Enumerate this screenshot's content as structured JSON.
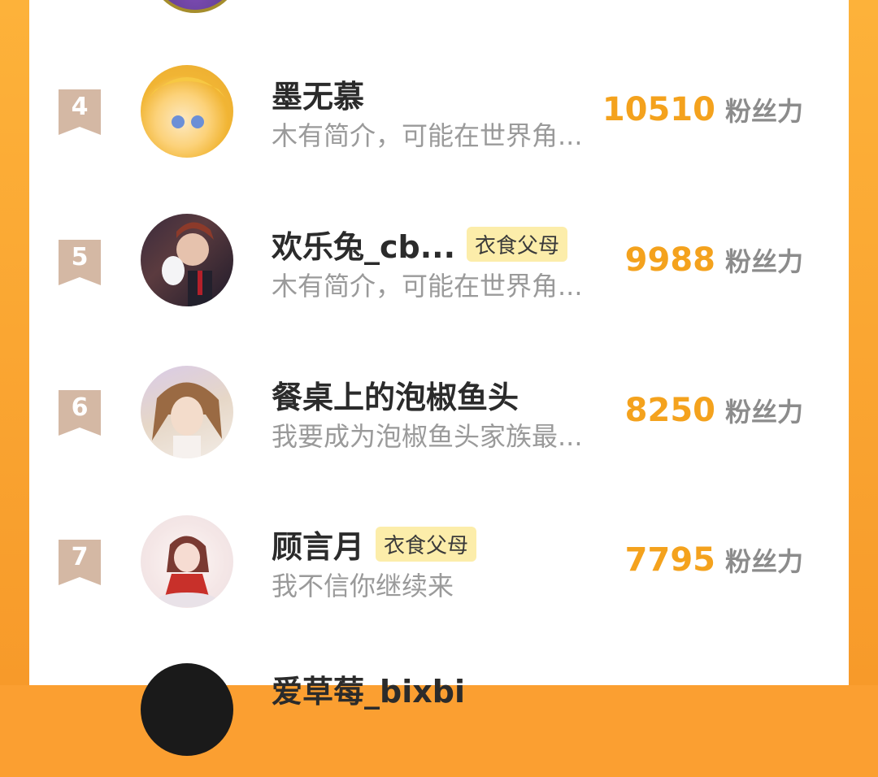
{
  "leaderboard": {
    "score_unit": "粉丝力",
    "rows": [
      {
        "rank": "4",
        "name": "墨无慕",
        "tag": "",
        "bio": "木有简介，可能在世界角...",
        "score": "10510"
      },
      {
        "rank": "5",
        "name": "欢乐兔_cb...",
        "tag": "衣食父母",
        "bio": "木有简介，可能在世界角...",
        "score": "9988"
      },
      {
        "rank": "6",
        "name": "餐桌上的泡椒鱼头",
        "tag": "",
        "bio": "我要成为泡椒鱼头家族最...",
        "score": "8250"
      },
      {
        "rank": "7",
        "name": "顾言月",
        "tag": "衣食父母",
        "bio": "我不信你继续来",
        "score": "7795"
      },
      {
        "rank": "",
        "name": "爱草莓_bixbi",
        "tag": "",
        "bio": "",
        "score": ""
      }
    ]
  },
  "colors": {
    "background": "#fb9f31",
    "score": "#f4a21d",
    "badge": "#d4b8a4",
    "tag_bg": "#fcedaa"
  },
  "icons": {
    "rank_badge": "ribbon-badge-icon",
    "avatar": "avatar-image"
  }
}
